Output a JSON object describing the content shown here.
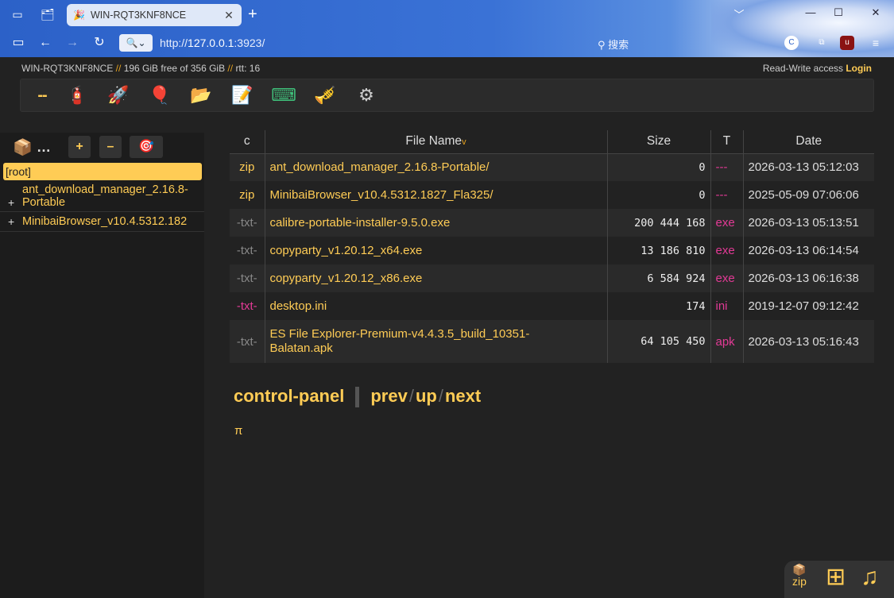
{
  "browser": {
    "tab_title": "WIN-RQT3KNF8NCE",
    "tab_close": "✕",
    "new_tab": "+",
    "url_scheme": "http://",
    "url_host": "127.0.0.1",
    "url_rest": ":3923/",
    "search_placeholder": "搜索",
    "window_controls": [
      "﹀",
      "—",
      "☐",
      "✕"
    ]
  },
  "status": {
    "host": "WIN-RQT3KNF8NCE",
    "sep1": " // ",
    "space": "196 GiB free of 356 GiB",
    "sep2": " // ",
    "rtt": "rtt: 16",
    "access": "Read-Write access",
    "login": "Login"
  },
  "toolbar": {
    "items": [
      {
        "name": "dash",
        "glyph": "--"
      },
      {
        "name": "fire-extinguisher-icon",
        "glyph": "🧯"
      },
      {
        "name": "rocket-icon",
        "glyph": "🚀"
      },
      {
        "name": "balloon-icon",
        "glyph": "🎈"
      },
      {
        "name": "folder-icon",
        "glyph": "📂"
      },
      {
        "name": "edit-note-icon",
        "glyph": "📝"
      },
      {
        "name": "keyboard-icon",
        "glyph": "⌨"
      },
      {
        "name": "trumpet-icon",
        "glyph": "🎺"
      },
      {
        "name": "gear-icon",
        "glyph": "⚙"
      }
    ]
  },
  "sidebar": {
    "pkg_icon": "📦",
    "dots": "…",
    "plus_btn": "+",
    "minus_btn": "–",
    "target_icon": "🎯",
    "root_label": "[root]",
    "items": [
      {
        "label": "ant_download_manager_2.16.8-",
        "label2": "Portable",
        "toggle": "+"
      },
      {
        "label": "MinibaiBrowser_v10.4.5312.182",
        "toggle": "+"
      }
    ]
  },
  "table": {
    "headers": {
      "c": "c",
      "name": "File Name",
      "sort": "v",
      "size": "Size",
      "type": "T",
      "date": "Date"
    },
    "rows": [
      {
        "c": "zip",
        "name": "ant_download_manager_2.16.8-Portable/",
        "size": "0",
        "type": "---",
        "date": "2026-03-13 05:12:03"
      },
      {
        "c": "zip",
        "name": "MinibaiBrowser_v10.4.5312.1827_Fla325/",
        "size": "0",
        "type": "---",
        "date": "2025-05-09 07:06:06"
      },
      {
        "c": "-txt-",
        "name": "calibre-portable-installer-9.5.0.exe",
        "size": "200 444 168",
        "type": "exe",
        "date": "2026-03-13 05:13:51"
      },
      {
        "c": "-txt-",
        "name": "copyparty_v1.20.12_x64.exe",
        "size": "13 186 810",
        "type": "exe",
        "date": "2026-03-13 06:14:54"
      },
      {
        "c": "-txt-",
        "name": "copyparty_v1.20.12_x86.exe",
        "size": "6 584 924",
        "type": "exe",
        "date": "2026-03-13 06:16:38"
      },
      {
        "c": "-txt-",
        "name": "desktop.ini",
        "size": "174",
        "type": "ini",
        "date": "2019-12-07 09:12:42"
      },
      {
        "c": "-txt-",
        "name": "ES File Explorer-Premium-v4.4.3.5_build_10351-",
        "name2": "Balatan.apk",
        "size": "64 105 450",
        "type": "apk",
        "date": "2026-03-13 05:16:43"
      }
    ]
  },
  "footer": {
    "control_panel": "control-panel",
    "prev": "prev",
    "up": "up",
    "next": "next",
    "slash": "/",
    "pi": "π"
  },
  "corner": {
    "zip_icon": "📦",
    "zip_label": "zip",
    "grid_icon": "⊞",
    "music_icon": "♫"
  }
}
